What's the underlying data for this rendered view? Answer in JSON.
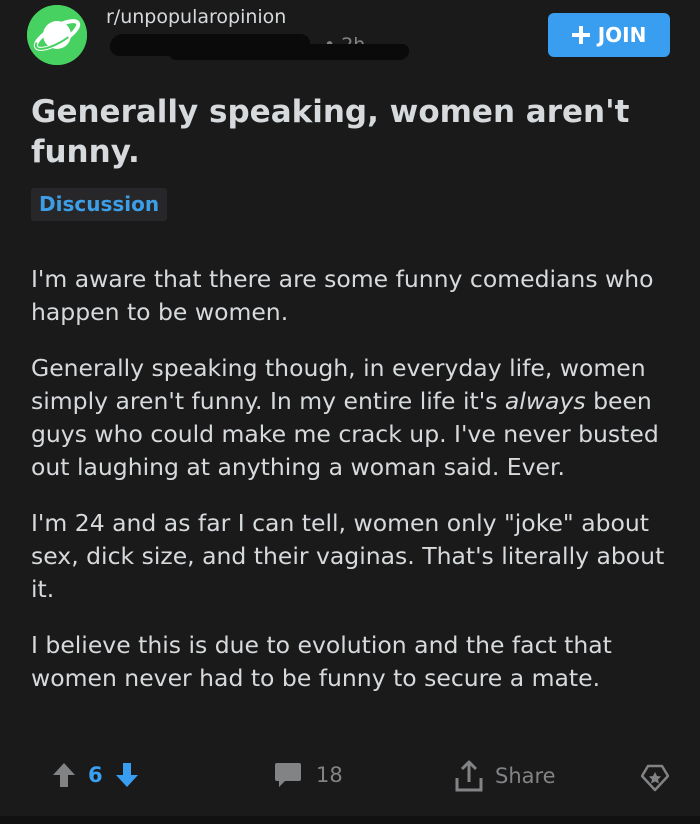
{
  "header": {
    "subreddit": "r/unpopularopinion",
    "time": "2h",
    "join_label": "JOIN"
  },
  "post": {
    "title": "Generally speaking, women aren't funny.",
    "flair": "Discussion",
    "paragraphs": {
      "p1": "I'm aware that there are some funny comedians who happen to be women.",
      "p2_a": "Generally speaking though, in everyday life, women simply aren't funny. In my entire life it's ",
      "p2_em": "always",
      "p2_b": " been guys who could make me crack up. I've never busted out laughing at anything a woman said. Ever.",
      "p3": "I'm 24 and as far I can tell, women only \"joke\" about sex, dick size, and their vaginas. That's literally about it.",
      "p4": "I believe this is due to evolution and the fact that women never had to be funny to secure a mate."
    }
  },
  "actions": {
    "votes": "6",
    "comments": "18",
    "share_label": "Share"
  },
  "colors": {
    "background": "#1a1a1b",
    "accent_blue": "#3a9ef0",
    "subreddit_icon_green": "#46d160",
    "text": "#d7dadc",
    "muted": "#818384"
  },
  "icons": [
    "planet-icon",
    "plus-icon",
    "upvote-icon",
    "downvote-icon",
    "comment-icon",
    "share-icon",
    "award-icon"
  ]
}
